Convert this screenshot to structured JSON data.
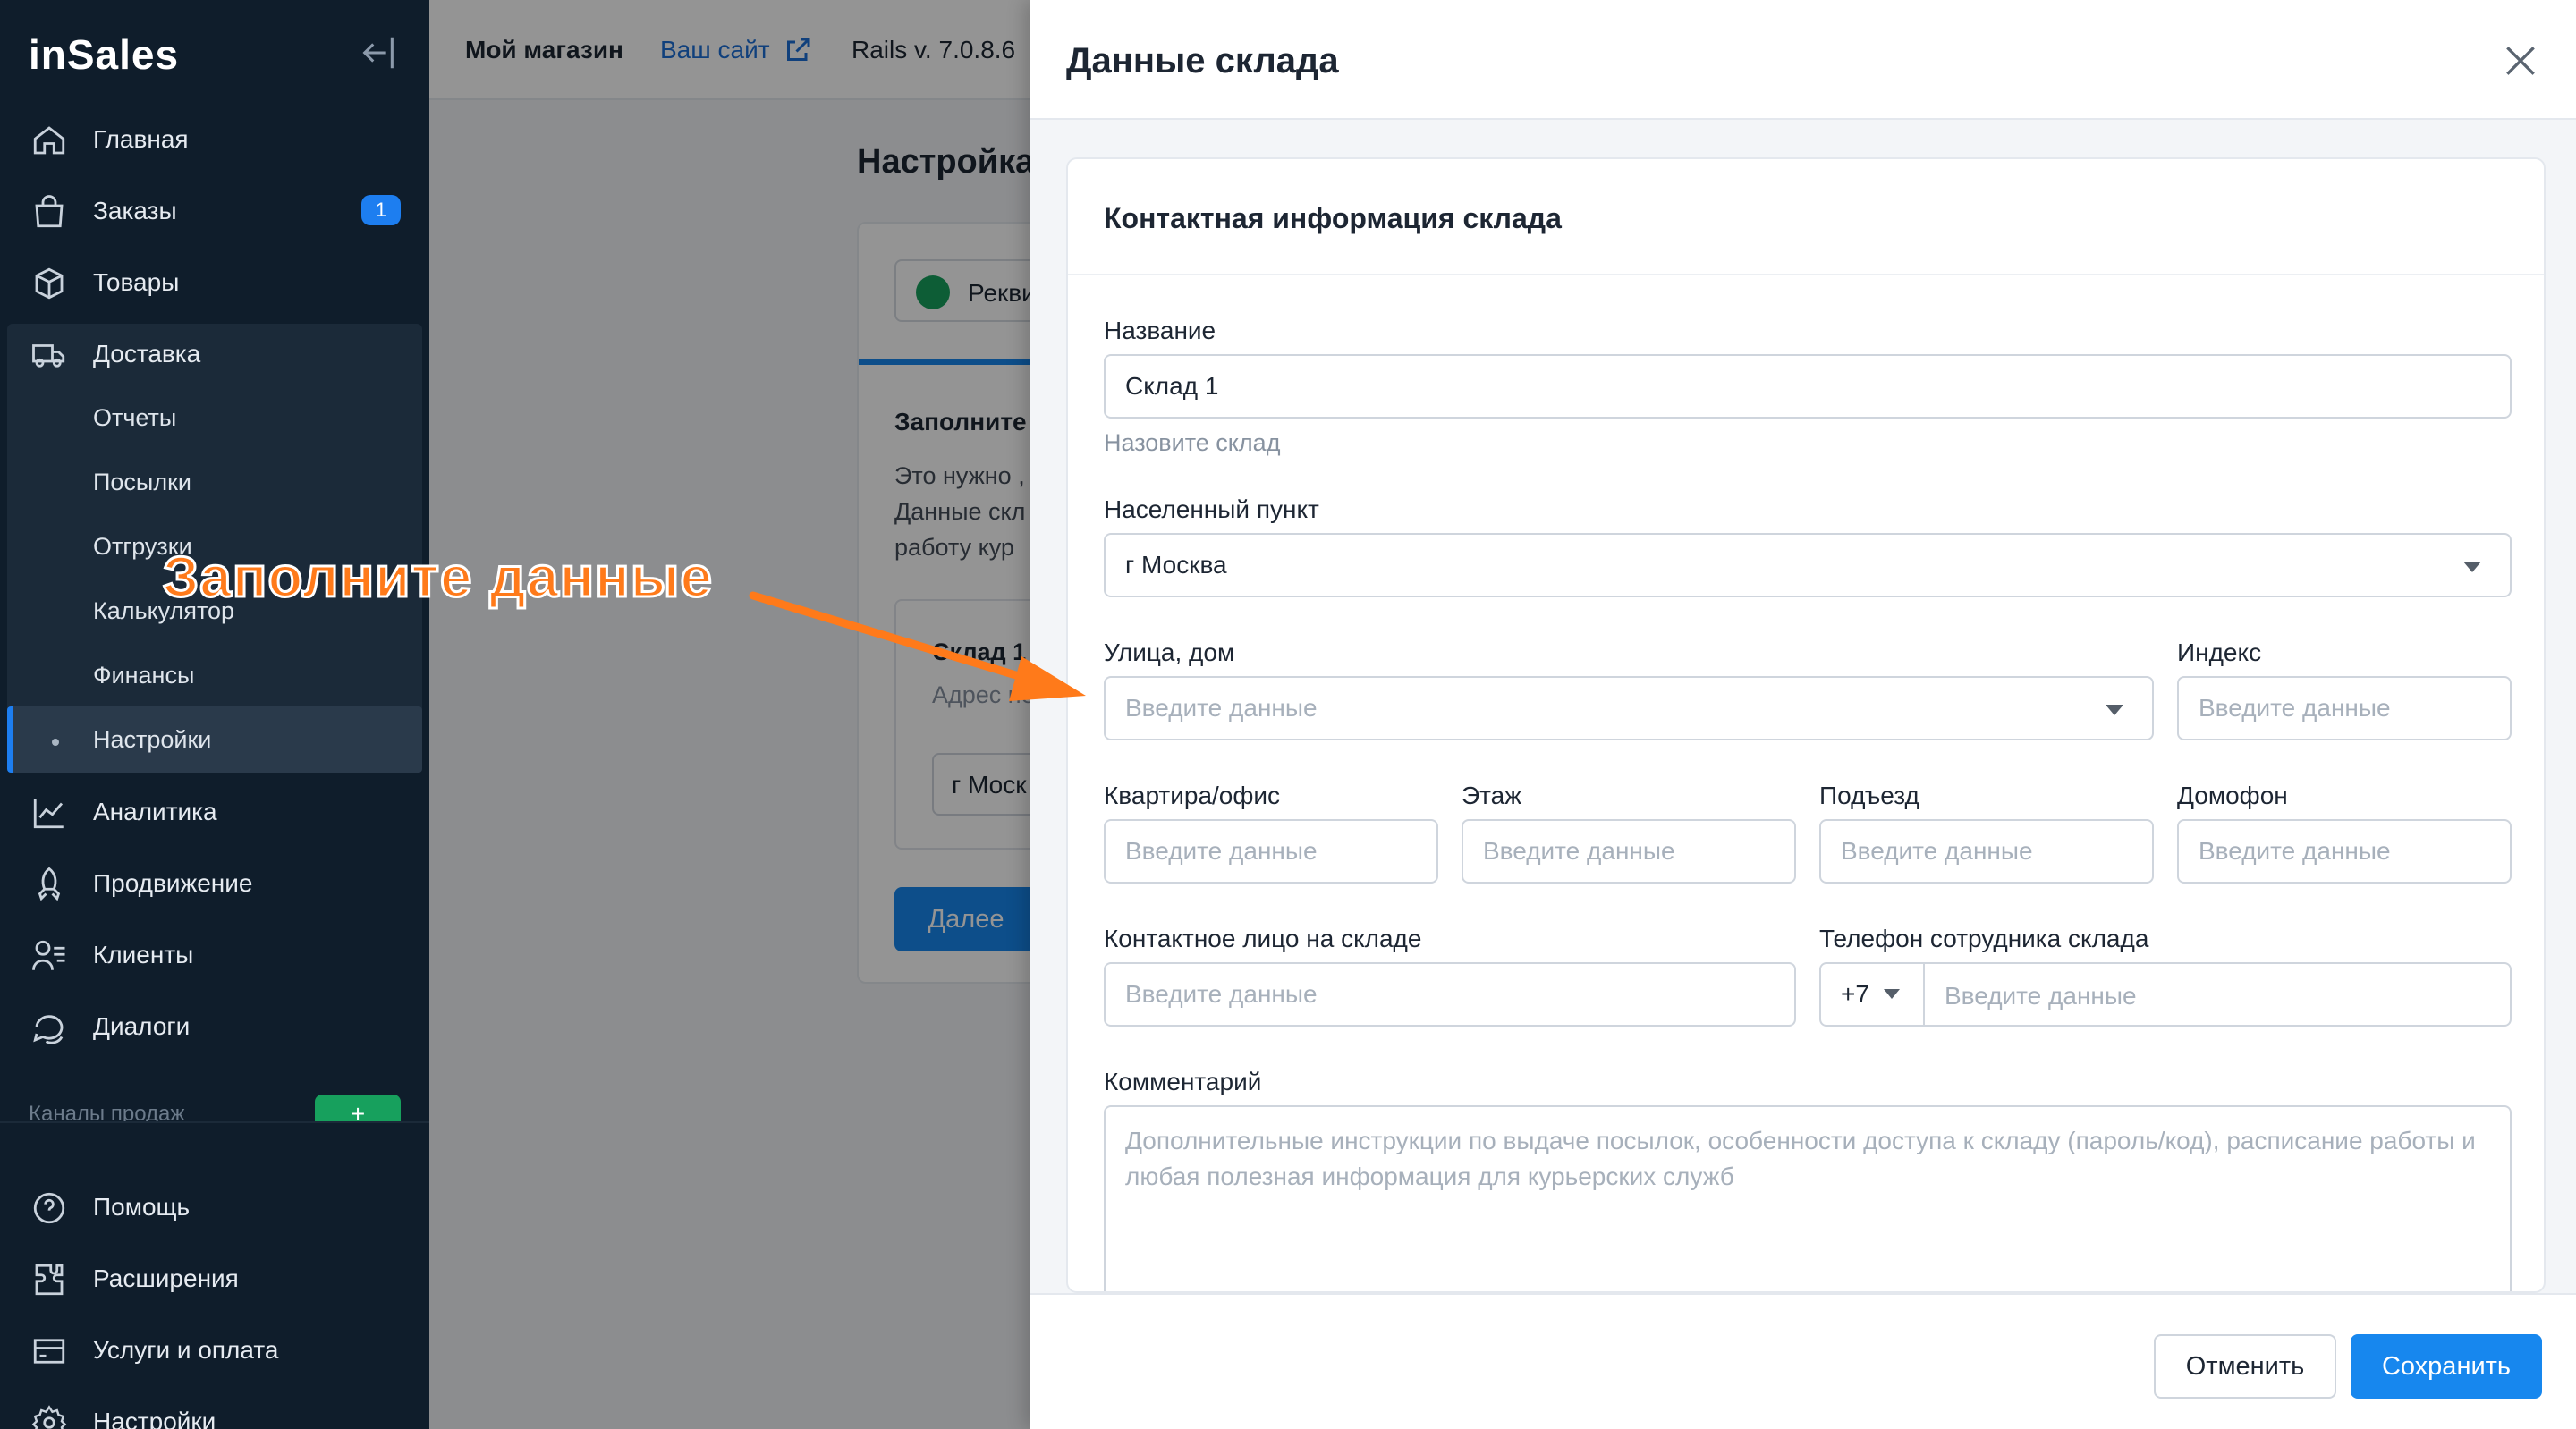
{
  "sidebar": {
    "logo": "inSales",
    "items": [
      {
        "label": "Главная",
        "icon": "home-icon"
      },
      {
        "label": "Заказы",
        "icon": "bag-icon",
        "badge": "1"
      },
      {
        "label": "Товары",
        "icon": "box-icon"
      },
      {
        "label": "Доставка",
        "icon": "truck-icon"
      }
    ],
    "delivery_sub": [
      "Отчеты",
      "Посылки",
      "Отгрузки",
      "Калькулятор",
      "Финансы",
      "Настройки"
    ],
    "items2": [
      {
        "label": "Аналитика",
        "icon": "chart-icon"
      },
      {
        "label": "Продвижение",
        "icon": "rocket-icon"
      },
      {
        "label": "Клиенты",
        "icon": "clients-icon"
      },
      {
        "label": "Диалоги",
        "icon": "chat-icon"
      }
    ],
    "channels_label": "Каналы продаж",
    "plus": "+",
    "bottom_items": [
      {
        "label": "Помощь",
        "icon": "help-icon"
      },
      {
        "label": "Расширения",
        "icon": "puzzle-icon"
      },
      {
        "label": "Услуги и оплата",
        "icon": "card-icon"
      },
      {
        "label": "Настройки",
        "icon": "gear-icon"
      }
    ]
  },
  "topbar": {
    "shop": "Мой магазин",
    "site_link": "Ваш сайт",
    "rails": "Rails v. 7.0.8.6"
  },
  "background": {
    "page_title": "Настройка",
    "step_label": "Рекви",
    "fill_title": "Заполните",
    "text_lines": [
      "Это нужно ,",
      "Данные скл",
      "работу кур"
    ],
    "warehouse": "Склад 1",
    "address_hint": "Адрес не",
    "city_value": "г Моск",
    "next_button": "Далее"
  },
  "modal": {
    "title": "Данные склада",
    "section_title": "Контактная информация склада",
    "name_label": "Название",
    "name_value": "Склад 1",
    "name_hint": "Назовите склад",
    "city_label": "Населенный пункт",
    "city_value": "г Москва",
    "street_label": "Улица, дом",
    "index_label": "Индекс",
    "apartment_label": "Квартира/офис",
    "floor_label": "Этаж",
    "entrance_label": "Подъезд",
    "intercom_label": "Домофон",
    "contact_label": "Контактное лицо на складе",
    "phone_label": "Телефон сотрудника склада",
    "phone_code": "+7",
    "comment_label": "Комментарий",
    "comment_placeholder": "Дополнительные инструкции по выдаче посылок, особенности доступа к складу (пароль/код), расписание работы и любая полезная информация для курьерских служб",
    "placeholder": "Введите данные",
    "cancel": "Отменить",
    "save": "Сохранить"
  },
  "annotation": {
    "text": "Заполните данные",
    "color": "#ff7a1a"
  }
}
